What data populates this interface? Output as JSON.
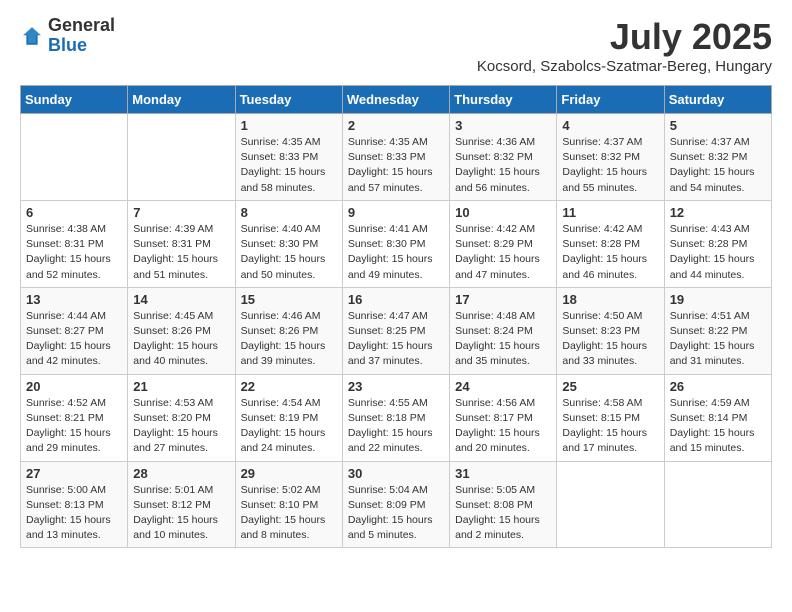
{
  "header": {
    "logo_general": "General",
    "logo_blue": "Blue",
    "month_title": "July 2025",
    "location": "Kocsord, Szabolcs-Szatmar-Bereg, Hungary"
  },
  "weekdays": [
    "Sunday",
    "Monday",
    "Tuesday",
    "Wednesday",
    "Thursday",
    "Friday",
    "Saturday"
  ],
  "weeks": [
    [
      {
        "day": "",
        "sunrise": "",
        "sunset": "",
        "daylight": ""
      },
      {
        "day": "",
        "sunrise": "",
        "sunset": "",
        "daylight": ""
      },
      {
        "day": "1",
        "sunrise": "Sunrise: 4:35 AM",
        "sunset": "Sunset: 8:33 PM",
        "daylight": "Daylight: 15 hours and 58 minutes."
      },
      {
        "day": "2",
        "sunrise": "Sunrise: 4:35 AM",
        "sunset": "Sunset: 8:33 PM",
        "daylight": "Daylight: 15 hours and 57 minutes."
      },
      {
        "day": "3",
        "sunrise": "Sunrise: 4:36 AM",
        "sunset": "Sunset: 8:32 PM",
        "daylight": "Daylight: 15 hours and 56 minutes."
      },
      {
        "day": "4",
        "sunrise": "Sunrise: 4:37 AM",
        "sunset": "Sunset: 8:32 PM",
        "daylight": "Daylight: 15 hours and 55 minutes."
      },
      {
        "day": "5",
        "sunrise": "Sunrise: 4:37 AM",
        "sunset": "Sunset: 8:32 PM",
        "daylight": "Daylight: 15 hours and 54 minutes."
      }
    ],
    [
      {
        "day": "6",
        "sunrise": "Sunrise: 4:38 AM",
        "sunset": "Sunset: 8:31 PM",
        "daylight": "Daylight: 15 hours and 52 minutes."
      },
      {
        "day": "7",
        "sunrise": "Sunrise: 4:39 AM",
        "sunset": "Sunset: 8:31 PM",
        "daylight": "Daylight: 15 hours and 51 minutes."
      },
      {
        "day": "8",
        "sunrise": "Sunrise: 4:40 AM",
        "sunset": "Sunset: 8:30 PM",
        "daylight": "Daylight: 15 hours and 50 minutes."
      },
      {
        "day": "9",
        "sunrise": "Sunrise: 4:41 AM",
        "sunset": "Sunset: 8:30 PM",
        "daylight": "Daylight: 15 hours and 49 minutes."
      },
      {
        "day": "10",
        "sunrise": "Sunrise: 4:42 AM",
        "sunset": "Sunset: 8:29 PM",
        "daylight": "Daylight: 15 hours and 47 minutes."
      },
      {
        "day": "11",
        "sunrise": "Sunrise: 4:42 AM",
        "sunset": "Sunset: 8:28 PM",
        "daylight": "Daylight: 15 hours and 46 minutes."
      },
      {
        "day": "12",
        "sunrise": "Sunrise: 4:43 AM",
        "sunset": "Sunset: 8:28 PM",
        "daylight": "Daylight: 15 hours and 44 minutes."
      }
    ],
    [
      {
        "day": "13",
        "sunrise": "Sunrise: 4:44 AM",
        "sunset": "Sunset: 8:27 PM",
        "daylight": "Daylight: 15 hours and 42 minutes."
      },
      {
        "day": "14",
        "sunrise": "Sunrise: 4:45 AM",
        "sunset": "Sunset: 8:26 PM",
        "daylight": "Daylight: 15 hours and 40 minutes."
      },
      {
        "day": "15",
        "sunrise": "Sunrise: 4:46 AM",
        "sunset": "Sunset: 8:26 PM",
        "daylight": "Daylight: 15 hours and 39 minutes."
      },
      {
        "day": "16",
        "sunrise": "Sunrise: 4:47 AM",
        "sunset": "Sunset: 8:25 PM",
        "daylight": "Daylight: 15 hours and 37 minutes."
      },
      {
        "day": "17",
        "sunrise": "Sunrise: 4:48 AM",
        "sunset": "Sunset: 8:24 PM",
        "daylight": "Daylight: 15 hours and 35 minutes."
      },
      {
        "day": "18",
        "sunrise": "Sunrise: 4:50 AM",
        "sunset": "Sunset: 8:23 PM",
        "daylight": "Daylight: 15 hours and 33 minutes."
      },
      {
        "day": "19",
        "sunrise": "Sunrise: 4:51 AM",
        "sunset": "Sunset: 8:22 PM",
        "daylight": "Daylight: 15 hours and 31 minutes."
      }
    ],
    [
      {
        "day": "20",
        "sunrise": "Sunrise: 4:52 AM",
        "sunset": "Sunset: 8:21 PM",
        "daylight": "Daylight: 15 hours and 29 minutes."
      },
      {
        "day": "21",
        "sunrise": "Sunrise: 4:53 AM",
        "sunset": "Sunset: 8:20 PM",
        "daylight": "Daylight: 15 hours and 27 minutes."
      },
      {
        "day": "22",
        "sunrise": "Sunrise: 4:54 AM",
        "sunset": "Sunset: 8:19 PM",
        "daylight": "Daylight: 15 hours and 24 minutes."
      },
      {
        "day": "23",
        "sunrise": "Sunrise: 4:55 AM",
        "sunset": "Sunset: 8:18 PM",
        "daylight": "Daylight: 15 hours and 22 minutes."
      },
      {
        "day": "24",
        "sunrise": "Sunrise: 4:56 AM",
        "sunset": "Sunset: 8:17 PM",
        "daylight": "Daylight: 15 hours and 20 minutes."
      },
      {
        "day": "25",
        "sunrise": "Sunrise: 4:58 AM",
        "sunset": "Sunset: 8:15 PM",
        "daylight": "Daylight: 15 hours and 17 minutes."
      },
      {
        "day": "26",
        "sunrise": "Sunrise: 4:59 AM",
        "sunset": "Sunset: 8:14 PM",
        "daylight": "Daylight: 15 hours and 15 minutes."
      }
    ],
    [
      {
        "day": "27",
        "sunrise": "Sunrise: 5:00 AM",
        "sunset": "Sunset: 8:13 PM",
        "daylight": "Daylight: 15 hours and 13 minutes."
      },
      {
        "day": "28",
        "sunrise": "Sunrise: 5:01 AM",
        "sunset": "Sunset: 8:12 PM",
        "daylight": "Daylight: 15 hours and 10 minutes."
      },
      {
        "day": "29",
        "sunrise": "Sunrise: 5:02 AM",
        "sunset": "Sunset: 8:10 PM",
        "daylight": "Daylight: 15 hours and 8 minutes."
      },
      {
        "day": "30",
        "sunrise": "Sunrise: 5:04 AM",
        "sunset": "Sunset: 8:09 PM",
        "daylight": "Daylight: 15 hours and 5 minutes."
      },
      {
        "day": "31",
        "sunrise": "Sunrise: 5:05 AM",
        "sunset": "Sunset: 8:08 PM",
        "daylight": "Daylight: 15 hours and 2 minutes."
      },
      {
        "day": "",
        "sunrise": "",
        "sunset": "",
        "daylight": ""
      },
      {
        "day": "",
        "sunrise": "",
        "sunset": "",
        "daylight": ""
      }
    ]
  ]
}
